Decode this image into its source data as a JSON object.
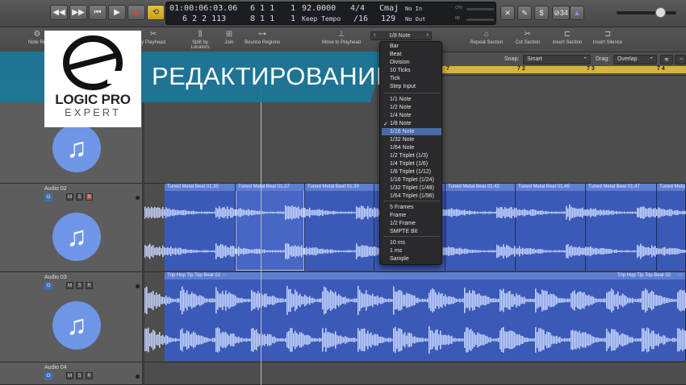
{
  "lcd": {
    "position_time": "01:00:06:03.06",
    "position_bars": "6 2 2 113",
    "bar_top": "6 1 1",
    "bar_top_tick": "1",
    "bar_bottom": "8 1 1",
    "bar_bottom_tick": "1",
    "tempo": "92.0000",
    "tempo_mode": "Keep Tempo",
    "signature": "4/4",
    "division": "/16",
    "key": "Cmaj",
    "key_value": "129",
    "midi_in": "No In",
    "midi_out": "No Out",
    "cpu_label": "CPU",
    "hd_label": "HD"
  },
  "control_bar": {
    "counter_badge": "⊘34"
  },
  "toolbar": {
    "note_repeat": "Note Re",
    "by_playhead": "y Playhead",
    "split_by_locators": "Split by Locators",
    "join": "Join",
    "bounce_regions": "Bounce Regions",
    "move_to_playhead": "Move to Playhead",
    "division_value": "1/8 Note",
    "repeat_section": "Repeat Section",
    "cut_section": "Cut Section",
    "insert_section": "Insert Section",
    "insert_silence": "Insert Silence"
  },
  "ruler": {
    "snap_label": "Snap:",
    "snap_value": "Smart",
    "drag_label": "Drag:",
    "drag_value": "Overlap",
    "ticks": [
      "7",
      "7 2",
      "7 3",
      "7 4"
    ]
  },
  "banner": {
    "title": "РЕДАКТИРОВАНИЕ",
    "logo_line1": "LOGIC PRO",
    "logo_line2": "EXPERT"
  },
  "tracks": [
    {
      "name": "Audio 02",
      "m": "M",
      "s": "S",
      "r": "R"
    },
    {
      "name": "Audio 03",
      "m": "M",
      "s": "S",
      "r": "R"
    },
    {
      "name": "Audio 04",
      "m": "M",
      "s": "S",
      "r": "R"
    }
  ],
  "regions_02": [
    "Tuned Metal Beat 01.35",
    "Tuned Metal Beat 01.37",
    "Tuned Metal Beat 01.39",
    "Tuned Metal Beat 01.43",
    "Tuned Metal Beat 01.45",
    "Tuned Metal Beat 01.47",
    "Tuned Metal Beat 01.49"
  ],
  "regions_03": {
    "left": "Trip Hop Tip Top Beat 02",
    "right": "Trip Hop Tip Top Beat 02"
  },
  "division_menu": [
    "Bar",
    "Beat",
    "Division",
    "10 Ticks",
    "Tick",
    "Step Input",
    "1/1 Note",
    "1/2 Note",
    "1/4 Note",
    "1/8 Note",
    "1/16 Note",
    "1/32 Note",
    "1/64 Note",
    "1/2 Triplet (1/3)",
    "1/4 Triplet (1/6)",
    "1/8 Triplet (1/12)",
    "1/16 Triplet (1/24)",
    "1/32 Triplet (1/48)",
    "1/64 Triplet (1/96)",
    "5 Frames",
    "Frame",
    "1/2 Frame",
    "SMPTE Bit",
    "10 ms",
    "1 ms",
    "Sample"
  ],
  "colors": {
    "region_blue": "#3b5ab8",
    "banner_teal": "#1c7699",
    "ruler_yellow": "#d8b23a",
    "track_icon": "#6f96e6"
  }
}
